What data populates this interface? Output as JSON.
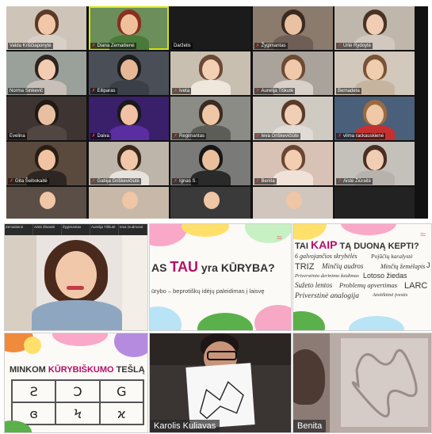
{
  "grid": {
    "participants": [
      {
        "name": "Valda Kriščiaponytė",
        "muted": false
      },
      {
        "name": "Diana Zemaitienė",
        "muted": true
      },
      {
        "name": "Darželis",
        "muted": false
      },
      {
        "name": "Žygimantas",
        "muted": true
      },
      {
        "name": "Urtė Rydoytė",
        "muted": true
      },
      {
        "name": "Norma Sinkevič",
        "muted": false
      },
      {
        "name": "Eiliparas",
        "muted": true
      },
      {
        "name": "Iveta",
        "muted": true
      },
      {
        "name": "Aurelija Tiškutė",
        "muted": true
      },
      {
        "name": "Bernadeta",
        "muted": false
      },
      {
        "name": "Evelina",
        "muted": false
      },
      {
        "name": "Daiva",
        "muted": true
      },
      {
        "name": "Regimantas",
        "muted": true
      },
      {
        "name": "Ieva Griškevičiūtė",
        "muted": true
      },
      {
        "name": "vilma rackauskienė",
        "muted": true
      },
      {
        "name": "Gita Šeibokaitė",
        "muted": true
      },
      {
        "name": "Gabija Griškevičiūtė",
        "muted": true
      },
      {
        "name": "Ignas S.",
        "muted": true
      },
      {
        "name": "Benita",
        "muted": true
      },
      {
        "name": "Aistė Žiūraitė",
        "muted": true
      }
    ]
  },
  "panels": {
    "strip_names": [
      "Zemaitienė",
      "Aistė Žiūraitė",
      "Žygimantas",
      "Aurelija Tiškutė",
      "Ieva Gudmonė"
    ],
    "slide1": {
      "title_pre": "AS ",
      "title_hl": "TAU",
      "title_post": " yra KŪRYBA?",
      "subtitle": "ūrybo – beprotiškų idėjų paleidimas į laisvę"
    },
    "slide2": {
      "title_pre": "TAI ",
      "title_hl": "KAIP",
      "title_post": " TĄ DUONĄ KEPTI?",
      "words": [
        "6 galvojančios skrybėlės",
        "Pojūčių karalystė",
        "TRIZ",
        "Minčių audros",
        "Minčių žemėlapis",
        "J",
        "Priverstinio derinimo žaidimas",
        "Lotoso žiedas",
        "Sužeto lentos",
        "Problemų apvertimas",
        "LARC",
        "Priverstinė analogija",
        "Atsitiktinė įvestis"
      ]
    },
    "slide3": {
      "title_pre": "MINKOM ",
      "title_hl": "KŪRYBIŠKUMO",
      "title_post": " TEŠLĄ",
      "cells": [
        "Ƨ",
        "Ɔ",
        "G",
        "ɞ",
        "Ϟ",
        "ϰ"
      ]
    },
    "video1": {
      "name": "Karolis Kuliavas"
    },
    "video2": {
      "name": "Benita"
    }
  }
}
